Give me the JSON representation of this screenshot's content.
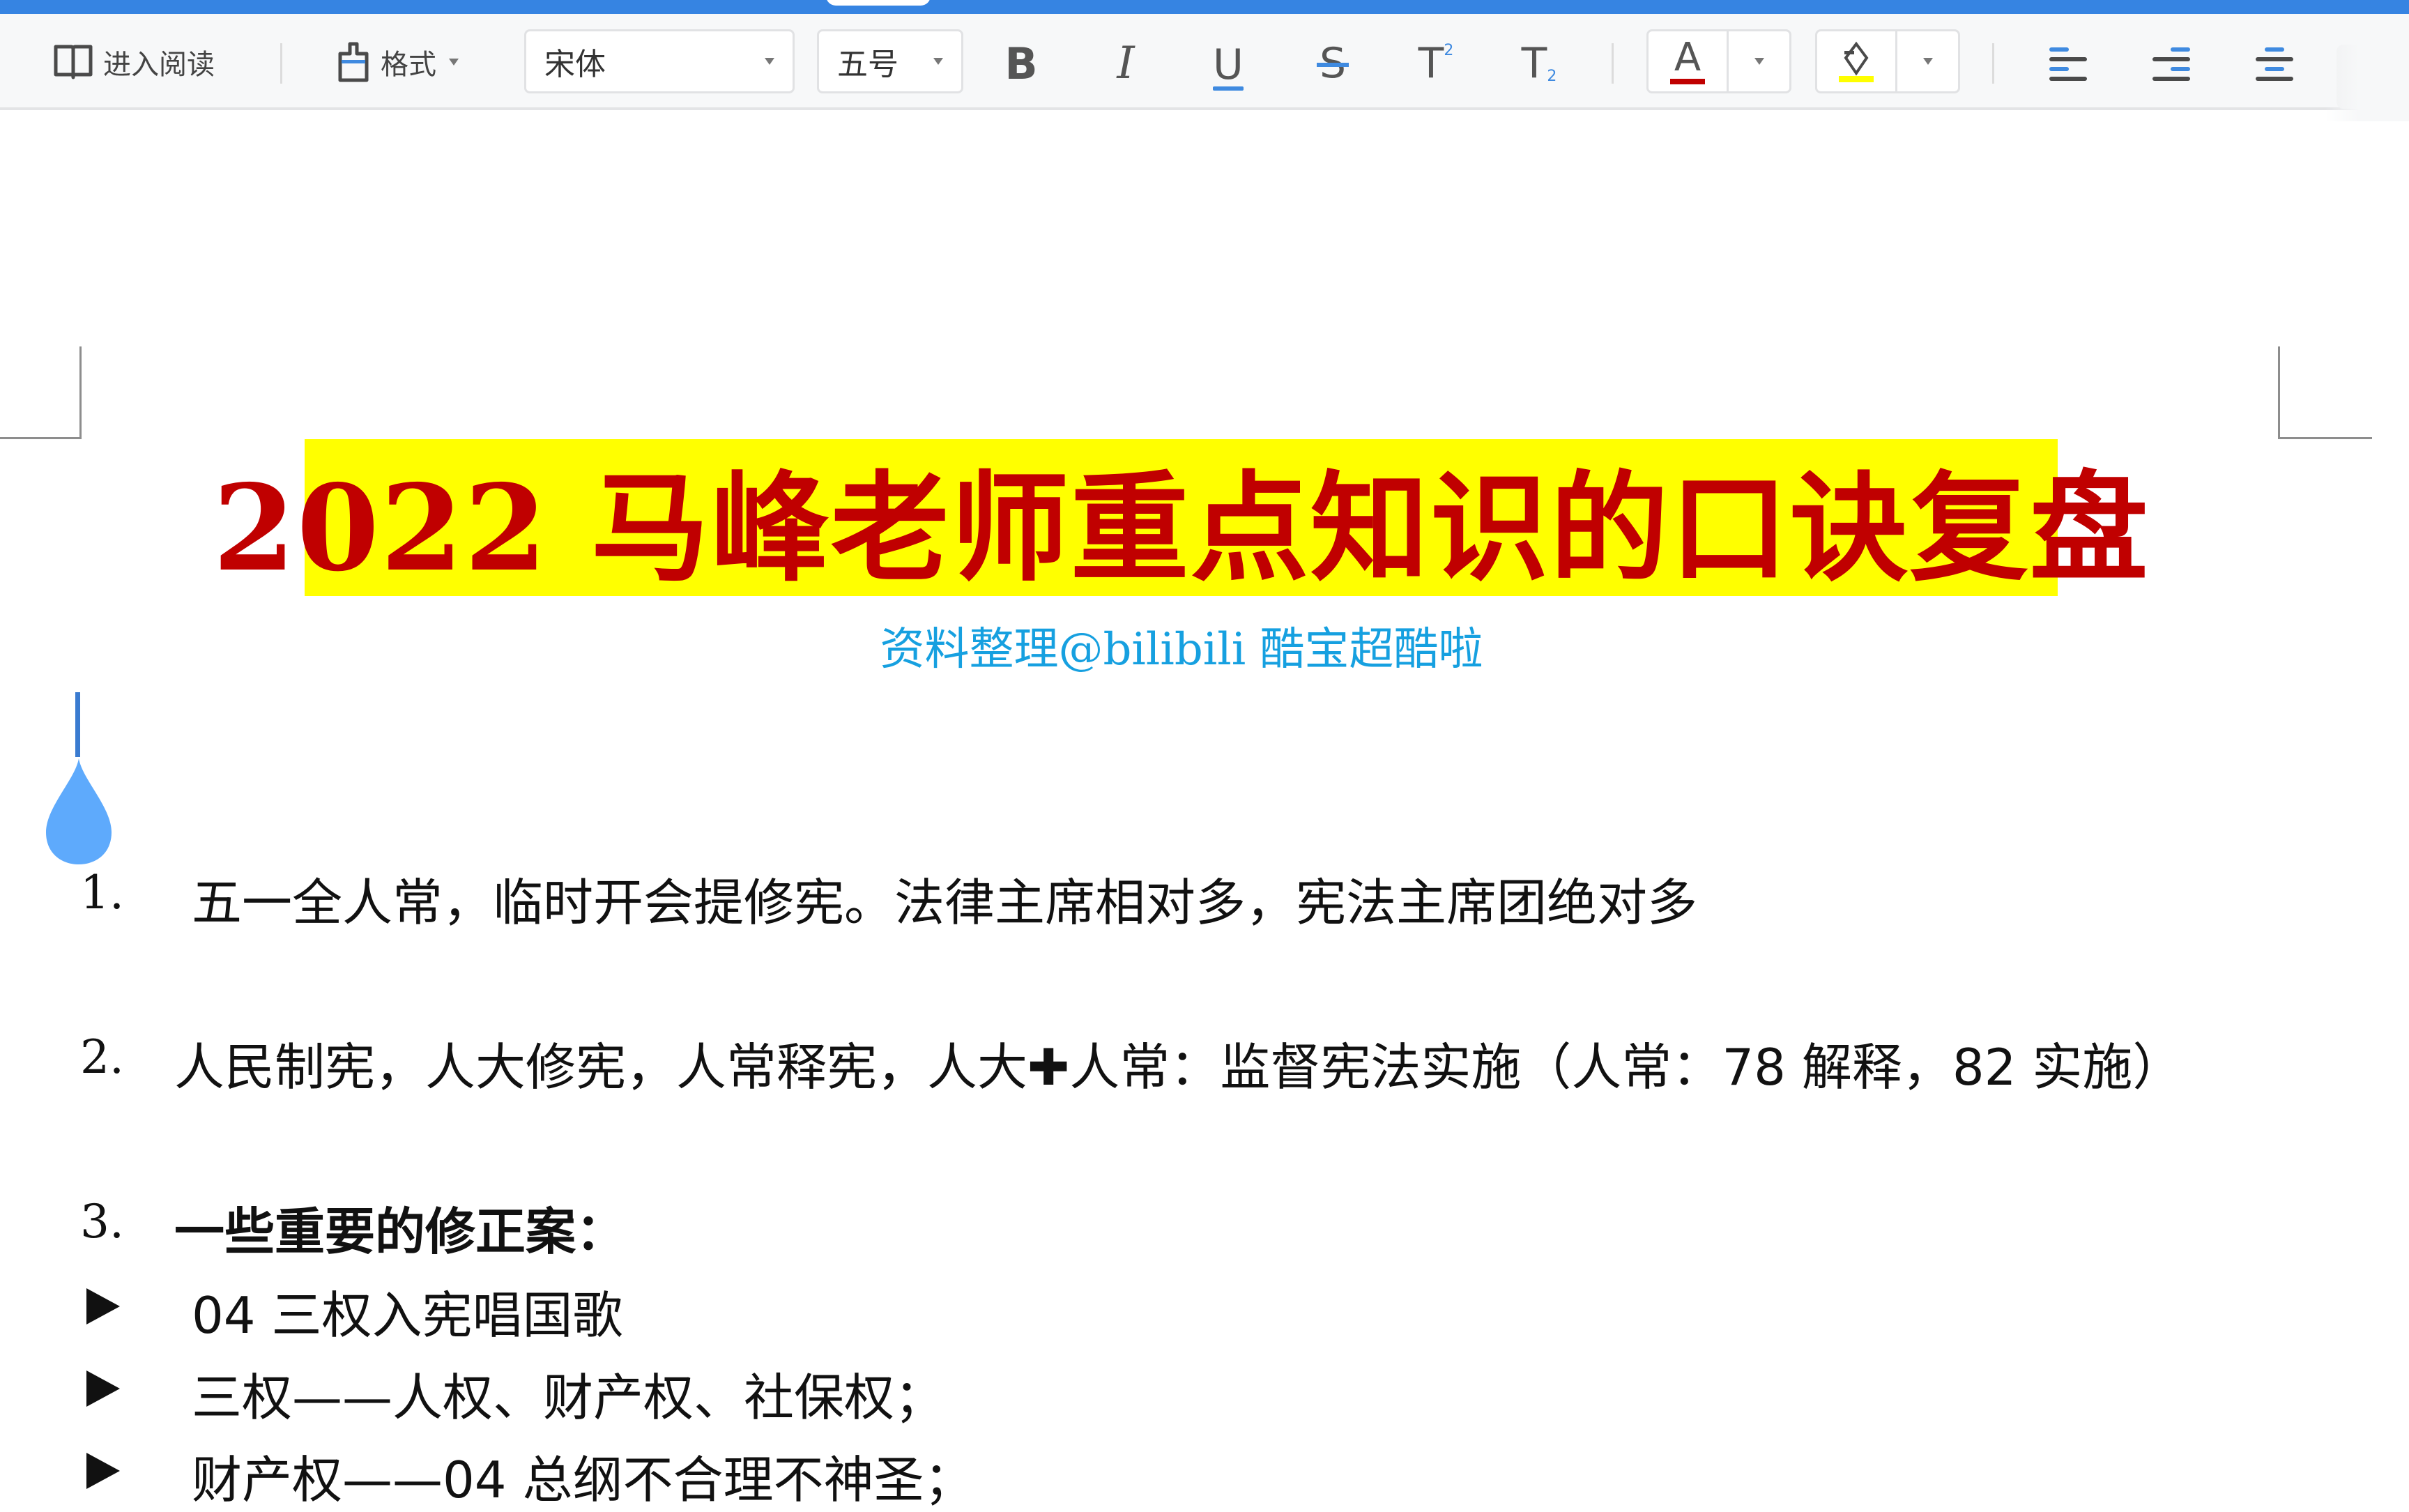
{
  "toolbar": {
    "reading_mode_label": "进入阅读",
    "format_label": "格式",
    "font_family": "宋体",
    "font_size": "五号",
    "bold_label": "B",
    "italic_label": "I",
    "underline_label": "U",
    "strike_label": "S",
    "superscript_label": "T",
    "superscript_mark": "2",
    "subscript_label": "T",
    "subscript_mark": "2",
    "font_color": "#c00000",
    "highlight_color": "#ffff00",
    "icons": [
      "book-icon",
      "format-painter-icon",
      "bold-icon",
      "italic-icon",
      "underline-icon",
      "strikethrough-icon",
      "superscript-icon",
      "subscript-icon",
      "font-color-icon",
      "highlight-icon",
      "align-left-icon",
      "align-right-icon",
      "align-center-icon"
    ]
  },
  "document": {
    "title": "2022 马峰老师重点知识的口诀复盘",
    "subtitle": "资料整理@bilibili 酷宝超酷啦",
    "items": [
      {
        "number": "1.",
        "text": "五一全人常，临时开会提修宪。法律主席相对多，宪法主席团绝对多"
      },
      {
        "number": "2.",
        "text": "人民制宪，人大修宪，人常释宪，人大✚人常：监督宪法实施（人常：78 解释，82 实施）"
      },
      {
        "number": "3.",
        "text": "一些重要的修正案："
      }
    ],
    "bullets": [
      {
        "text": "04 三权入宪唱国歌"
      },
      {
        "text": "三权——人权、财产权、社保权；"
      },
      {
        "text": "财产权——04 总纲不合理不神圣；"
      }
    ]
  }
}
